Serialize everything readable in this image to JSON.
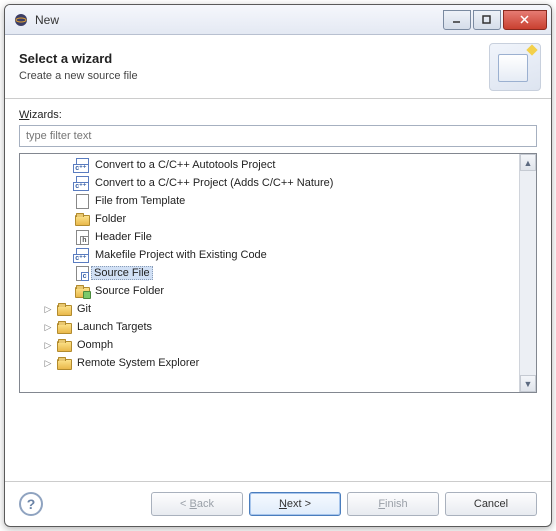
{
  "window": {
    "title": "New"
  },
  "banner": {
    "heading": "Select a wizard",
    "sub": "Create a new source file"
  },
  "wizardsLabel": "Wizards:",
  "filter": {
    "placeholder": "type filter text"
  },
  "tree": {
    "items": [
      {
        "label": "Convert to a C/C++ Autotools Project",
        "indent": 54,
        "icon": "cpp-file"
      },
      {
        "label": "Convert to a C/C++ Project (Adds C/C++ Nature)",
        "indent": 54,
        "icon": "cpp-file"
      },
      {
        "label": "File from Template",
        "indent": 54,
        "icon": "file"
      },
      {
        "label": "Folder",
        "indent": 54,
        "icon": "folder"
      },
      {
        "label": "Header File",
        "indent": 54,
        "icon": "h-file"
      },
      {
        "label": "Makefile Project with Existing Code",
        "indent": 54,
        "icon": "cpp-file"
      },
      {
        "label": "Source File",
        "indent": 54,
        "icon": "c-file",
        "selected": true
      },
      {
        "label": "Source Folder",
        "indent": 54,
        "icon": "src-folder"
      },
      {
        "label": "Git",
        "indent": 36,
        "icon": "folder",
        "expander": "right"
      },
      {
        "label": "Launch Targets",
        "indent": 36,
        "icon": "folder",
        "expander": "right"
      },
      {
        "label": "Oomph",
        "indent": 36,
        "icon": "folder",
        "expander": "right"
      },
      {
        "label": "Remote System Explorer",
        "indent": 36,
        "icon": "folder",
        "expander": "right"
      }
    ]
  },
  "buttons": {
    "back": "< Back",
    "next": "Next >",
    "finish": "Finish",
    "cancel": "Cancel"
  }
}
